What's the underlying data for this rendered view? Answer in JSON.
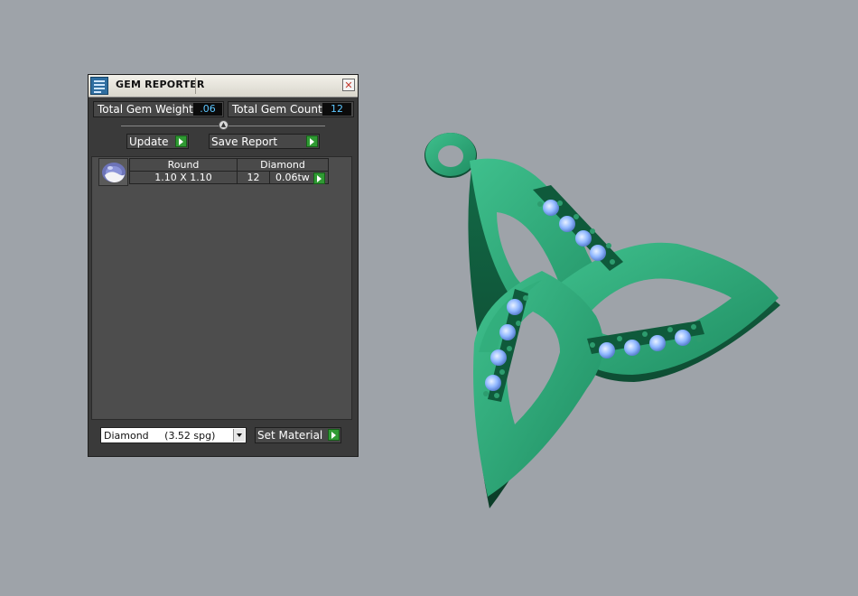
{
  "window": {
    "title": "GEM REPORTER",
    "close_symbol": "✕"
  },
  "stats": {
    "total_weight_label": "Total Gem Weight",
    "total_weight_value": ".06",
    "total_count_label": "Total Gem Count",
    "total_count_value": "12"
  },
  "toolbar": {
    "update_label": "Update",
    "save_report_label": "Save Report"
  },
  "gem_table": {
    "rows": [
      {
        "shape": "Round",
        "material": "Diamond",
        "size": "1.10 X 1.10",
        "count": "12",
        "weight": "0.06tw"
      }
    ]
  },
  "material": {
    "selected": "Diamond     (3.52 spg)",
    "set_label": "Set Material"
  },
  "colors": {
    "accent_green": "#2f9a33",
    "value_blue": "#5ec7ff",
    "pendant_green": "#1f9a6a",
    "gem_blue": "#8fb7ff"
  },
  "viewport": {
    "model": "celtic-trinity-pendant",
    "gem_count_visible": 12
  }
}
